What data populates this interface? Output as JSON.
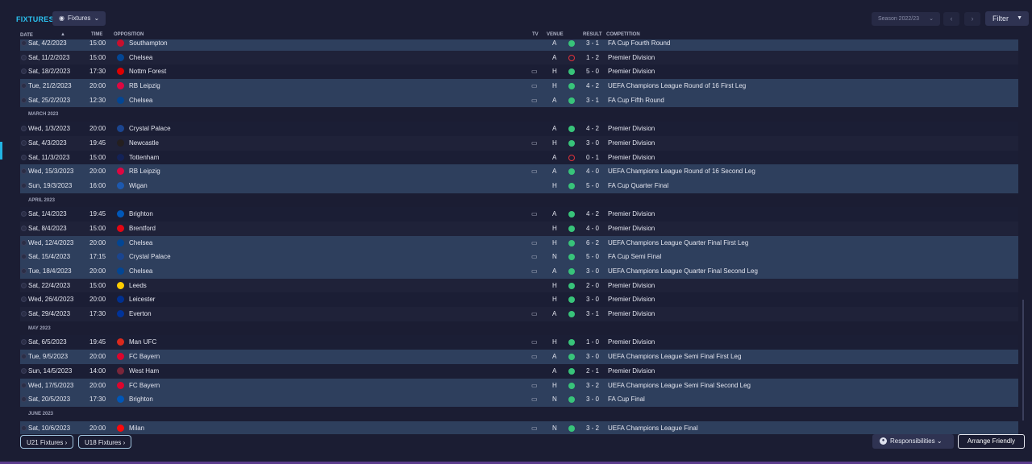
{
  "header": {
    "title": "FIXTURES",
    "view_button": "Fixtures",
    "season": "Season 2022/23",
    "filter": "Filter"
  },
  "columns": {
    "date": "DATE",
    "time": "TIME",
    "opposition": "OPPOSITION",
    "tv": "TV",
    "venue": "VENUE",
    "result": "RESULT",
    "competition": "COMPETITION"
  },
  "colors": {
    "accent": "#2bc1ef",
    "win": "#38c47a",
    "loss": "#e0323a",
    "highlight_row": "#2e3f5d"
  },
  "rows": [
    {
      "type": "fixture",
      "date": "Sat, 4/2/2023",
      "time": "15:00",
      "opp": "Southampton",
      "crest": "#c8102e",
      "tv": false,
      "venue": "A",
      "outcome": "win",
      "result": "3 - 1",
      "comp": "FA Cup Fourth Round",
      "hl": true
    },
    {
      "type": "fixture",
      "date": "Sat, 11/2/2023",
      "time": "15:00",
      "opp": "Chelsea",
      "crest": "#034694",
      "tv": false,
      "venue": "A",
      "outcome": "loss",
      "result": "1 - 2",
      "comp": "Premier Division",
      "hl": false
    },
    {
      "type": "fixture",
      "date": "Sat, 18/2/2023",
      "time": "17:30",
      "opp": "Nottm Forest",
      "crest": "#dd0000",
      "tv": true,
      "venue": "H",
      "outcome": "win",
      "result": "5 - 0",
      "comp": "Premier Division",
      "hl": false
    },
    {
      "type": "fixture",
      "date": "Tue, 21/2/2023",
      "time": "20:00",
      "opp": "RB Leipzig",
      "crest": "#dd0741",
      "tv": true,
      "venue": "H",
      "outcome": "win",
      "result": "4 - 2",
      "comp": "UEFA Champions League Round of 16  First Leg",
      "hl": true
    },
    {
      "type": "fixture",
      "date": "Sat, 25/2/2023",
      "time": "12:30",
      "opp": "Chelsea",
      "crest": "#034694",
      "tv": true,
      "venue": "A",
      "outcome": "win",
      "result": "3 - 1",
      "comp": "FA Cup Fifth Round",
      "hl": true
    },
    {
      "type": "month",
      "label": "MARCH 2023"
    },
    {
      "type": "fixture",
      "date": "Wed, 1/3/2023",
      "time": "20:00",
      "opp": "Crystal Palace",
      "crest": "#1b458f",
      "tv": false,
      "venue": "A",
      "outcome": "win",
      "result": "4 - 2",
      "comp": "Premier Division",
      "hl": false
    },
    {
      "type": "fixture",
      "date": "Sat, 4/3/2023",
      "time": "19:45",
      "opp": "Newcastle",
      "crest": "#241f20",
      "tv": true,
      "venue": "H",
      "outcome": "win",
      "result": "3 - 0",
      "comp": "Premier Division",
      "hl": false
    },
    {
      "type": "fixture",
      "date": "Sat, 11/3/2023",
      "time": "15:00",
      "opp": "Tottenham",
      "crest": "#132257",
      "tv": false,
      "venue": "A",
      "outcome": "loss",
      "result": "0 - 1",
      "comp": "Premier Division",
      "hl": false
    },
    {
      "type": "fixture",
      "date": "Wed, 15/3/2023",
      "time": "20:00",
      "opp": "RB Leipzig",
      "crest": "#dd0741",
      "tv": true,
      "venue": "A",
      "outcome": "win",
      "result": "4 - 0",
      "comp": "UEFA Champions League Round of 16  Second Leg",
      "hl": true
    },
    {
      "type": "fixture",
      "date": "Sun, 19/3/2023",
      "time": "16:00",
      "opp": "Wigan",
      "crest": "#1d59af",
      "tv": false,
      "venue": "H",
      "outcome": "win",
      "result": "5 - 0",
      "comp": "FA Cup Quarter Final",
      "hl": true
    },
    {
      "type": "month",
      "label": "APRIL 2023"
    },
    {
      "type": "fixture",
      "date": "Sat, 1/4/2023",
      "time": "19:45",
      "opp": "Brighton",
      "crest": "#0057b8",
      "tv": true,
      "venue": "A",
      "outcome": "win",
      "result": "4 - 2",
      "comp": "Premier Division",
      "hl": false
    },
    {
      "type": "fixture",
      "date": "Sat, 8/4/2023",
      "time": "15:00",
      "opp": "Brentford",
      "crest": "#e30613",
      "tv": false,
      "venue": "H",
      "outcome": "win",
      "result": "4 - 0",
      "comp": "Premier Division",
      "hl": false
    },
    {
      "type": "fixture",
      "date": "Wed, 12/4/2023",
      "time": "20:00",
      "opp": "Chelsea",
      "crest": "#034694",
      "tv": true,
      "venue": "H",
      "outcome": "win",
      "result": "6 - 2",
      "comp": "UEFA Champions League Quarter Final First Leg",
      "hl": true
    },
    {
      "type": "fixture",
      "date": "Sat, 15/4/2023",
      "time": "17:15",
      "opp": "Crystal Palace",
      "crest": "#1b458f",
      "tv": true,
      "venue": "N",
      "outcome": "win",
      "result": "5 - 0",
      "comp": "FA Cup Semi Final",
      "hl": true
    },
    {
      "type": "fixture",
      "date": "Tue, 18/4/2023",
      "time": "20:00",
      "opp": "Chelsea",
      "crest": "#034694",
      "tv": true,
      "venue": "A",
      "outcome": "win",
      "result": "3 - 0",
      "comp": "UEFA Champions League Quarter Final Second Leg",
      "hl": true
    },
    {
      "type": "fixture",
      "date": "Sat, 22/4/2023",
      "time": "15:00",
      "opp": "Leeds",
      "crest": "#ffcd00",
      "tv": false,
      "venue": "H",
      "outcome": "win",
      "result": "2 - 0",
      "comp": "Premier Division",
      "hl": false
    },
    {
      "type": "fixture",
      "date": "Wed, 26/4/2023",
      "time": "20:00",
      "opp": "Leicester",
      "crest": "#003090",
      "tv": false,
      "venue": "H",
      "outcome": "win",
      "result": "3 - 0",
      "comp": "Premier Division",
      "hl": false
    },
    {
      "type": "fixture",
      "date": "Sat, 29/4/2023",
      "time": "17:30",
      "opp": "Everton",
      "crest": "#003399",
      "tv": true,
      "venue": "A",
      "outcome": "win",
      "result": "3 - 1",
      "comp": "Premier Division",
      "hl": false
    },
    {
      "type": "month",
      "label": "MAY 2023"
    },
    {
      "type": "fixture",
      "date": "Sat, 6/5/2023",
      "time": "19:45",
      "opp": "Man UFC",
      "crest": "#da291c",
      "tv": true,
      "venue": "H",
      "outcome": "win",
      "result": "1 - 0",
      "comp": "Premier Division",
      "hl": false
    },
    {
      "type": "fixture",
      "date": "Tue, 9/5/2023",
      "time": "20:00",
      "opp": "FC Bayern",
      "crest": "#dc052d",
      "tv": true,
      "venue": "A",
      "outcome": "win",
      "result": "3 - 0",
      "comp": "UEFA Champions League Semi Final First Leg",
      "hl": true
    },
    {
      "type": "fixture",
      "date": "Sun, 14/5/2023",
      "time": "14:00",
      "opp": "West Ham",
      "crest": "#7a263a",
      "tv": false,
      "venue": "A",
      "outcome": "win",
      "result": "2 - 1",
      "comp": "Premier Division",
      "hl": false
    },
    {
      "type": "fixture",
      "date": "Wed, 17/5/2023",
      "time": "20:00",
      "opp": "FC Bayern",
      "crest": "#dc052d",
      "tv": true,
      "venue": "H",
      "outcome": "win",
      "result": "3 - 2",
      "comp": "UEFA Champions League Semi Final Second Leg",
      "hl": true
    },
    {
      "type": "fixture",
      "date": "Sat, 20/5/2023",
      "time": "17:30",
      "opp": "Brighton",
      "crest": "#0057b8",
      "tv": true,
      "venue": "N",
      "outcome": "win",
      "result": "3 - 0",
      "comp": "FA Cup Final",
      "hl": true
    },
    {
      "type": "month",
      "label": "JUNE 2023"
    },
    {
      "type": "fixture",
      "date": "Sat, 10/6/2023",
      "time": "20:00",
      "opp": "Milan",
      "crest": "#fb090b",
      "tv": true,
      "venue": "N",
      "outcome": "win",
      "result": "3 - 2",
      "comp": "UEFA Champions League Final",
      "hl": true
    }
  ],
  "footer": {
    "u21": "U21 Fixtures",
    "u18": "U18 Fixtures",
    "responsibilities": "Responsibilities",
    "arrange": "Arrange Friendly"
  }
}
